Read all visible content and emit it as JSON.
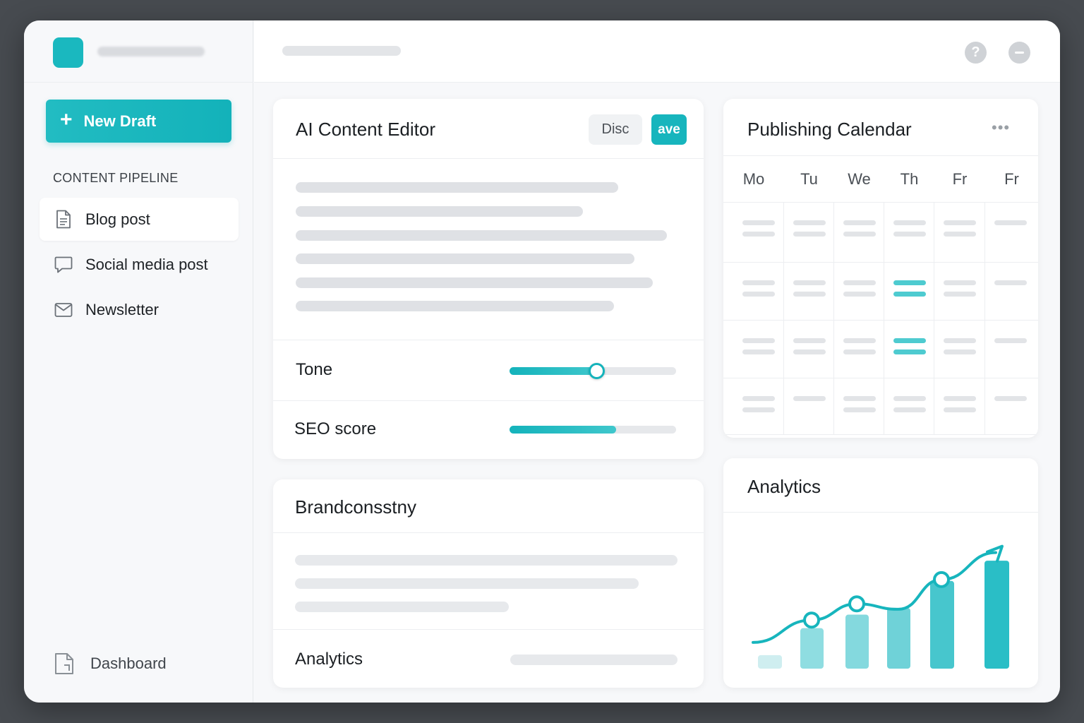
{
  "sidebar": {
    "new_draft_label": "New Draft",
    "section_label": "CONTENT PIPELINE",
    "items": [
      {
        "label": "Blog post",
        "icon": "document-icon",
        "active": true
      },
      {
        "label": "Social media post",
        "icon": "chat-bubble-icon",
        "active": false
      },
      {
        "label": "Newsletter",
        "icon": "envelope-icon",
        "active": false
      }
    ],
    "footer_label": "Dashboard"
  },
  "topbar": {
    "help_label": "?"
  },
  "editor": {
    "title": "AI Content Editor",
    "discard_label": "Disc",
    "save_label": "ave",
    "tone_label": "Tone",
    "tone_value": 0.52,
    "seo_label": "SEO score",
    "seo_value": 0.64
  },
  "brand": {
    "title": "Brandconsstny",
    "analytics_label": "Analytics"
  },
  "calendar": {
    "title": "Publishing Calendar",
    "more_label": "•••",
    "days": [
      "Mo",
      "Tu",
      "We",
      "Th",
      "Fr",
      "Fr"
    ]
  },
  "analytics": {
    "title": "Analytics"
  },
  "chart_data": {
    "type": "bar",
    "bar_values": [
      1,
      3,
      4,
      4.5,
      6.5,
      8
    ],
    "line_values": [
      1,
      3.6,
      4.8,
      4.4,
      6.6,
      8.6
    ],
    "line_markers": [
      1,
      2,
      4
    ],
    "colors": {
      "accent": "#17b5bd",
      "bars": [
        "#cfeef0",
        "#8fdde1",
        "#84d9de",
        "#6fd2d8",
        "#47c6cd",
        "#2abec6"
      ]
    }
  },
  "colors": {
    "accent": "#17b5bd",
    "background": "#474b50"
  }
}
